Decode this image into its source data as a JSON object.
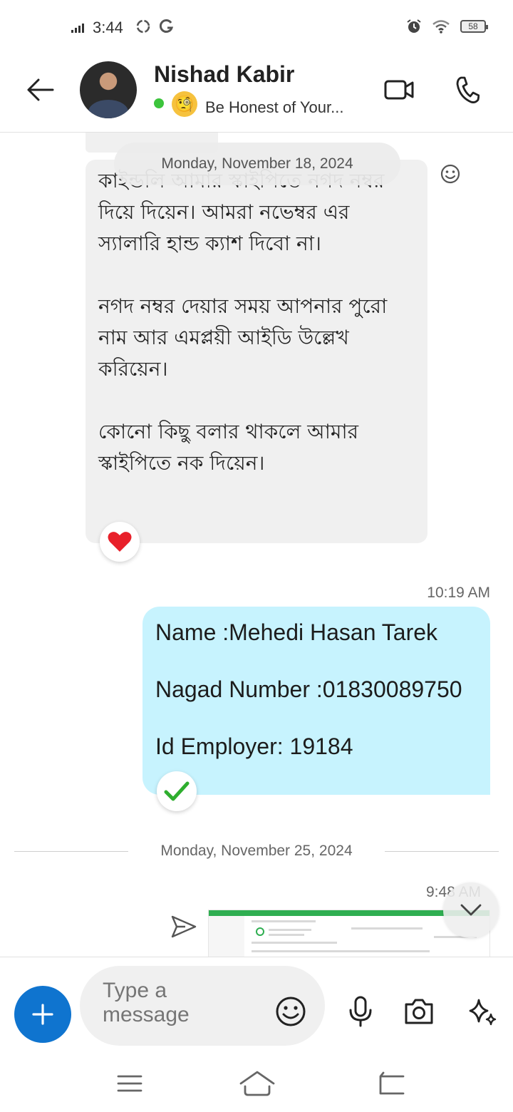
{
  "status_bar": {
    "time": "3:44",
    "left_icons": [
      "sync-icon",
      "g-icon"
    ],
    "battery_level": "58"
  },
  "header": {
    "contact_name": "Nishad Kabir",
    "presence": "online",
    "mood_emoji": "🧐",
    "status_message": "Be Honest of Your..."
  },
  "messages": {
    "incoming_text": "কাইন্ডলি আমার স্কাইপিতে নগদ নম্বর দিয়ে দিয়েন। আমরা নভেম্বর এর স্যালারি হান্ড ক্যাশ দিবো না।",
    "incoming_text_2": "নগদ নম্বর দেয়ার সময় আপনার পুরো নাম আর এমপ্লয়ী আইডি উল্লেখ করিয়েন।",
    "incoming_text_3": "কোনো কিছু বলার থাকলে আমার স্কাইপিতে নক দিয়েন।",
    "date_1": "Monday, November 18, 2024",
    "incoming_reaction": "heart",
    "outgoing_time": "10:19 AM",
    "outgoing_lines": [
      "Name :Mehedi Hasan Tarek",
      "Nagad Number :01830089750",
      "Id Employer: 19184"
    ],
    "outgoing_reaction": "check",
    "date_2": "Monday, November 25, 2024",
    "image_time": "9:48 AM"
  },
  "composer": {
    "placeholder": "Type a message"
  },
  "colors": {
    "accent": "#0f74cf",
    "outgoing_bubble": "#c7f3fe",
    "incoming_bubble": "#f0f0f0",
    "presence": "#3cc43c",
    "heart": "#e8202a",
    "check": "#2eae2e"
  }
}
